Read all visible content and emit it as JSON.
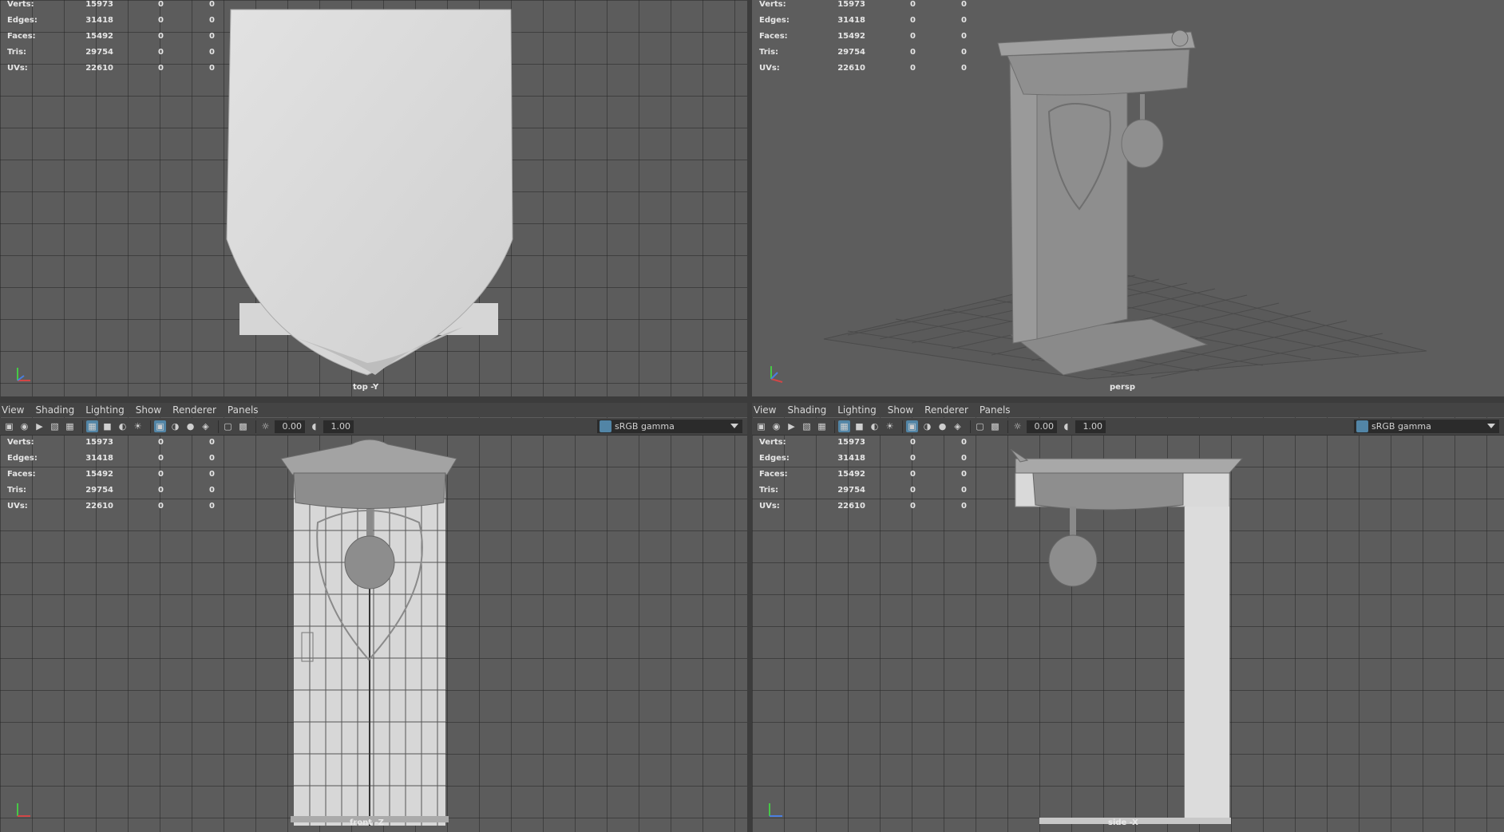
{
  "menu": [
    "View",
    "Shading",
    "Lighting",
    "Show",
    "Renderer",
    "Panels"
  ],
  "hud": {
    "labels": [
      "Verts:",
      "Edges:",
      "Faces:",
      "Tris:",
      "UVs:"
    ],
    "values": [
      "15973",
      "31418",
      "15492",
      "29754",
      "22610"
    ],
    "col2": "0",
    "col3": "0"
  },
  "toolbar": {
    "exposure": "0.00",
    "gamma": "1.00",
    "colorspace": "sRGB gamma"
  },
  "cameras": {
    "top": "top -Y",
    "persp": "persp",
    "front": "front -Z",
    "side": "side -X"
  },
  "axis": {
    "y": "Y",
    "x": "X",
    "z": "Z"
  },
  "colors": {
    "accent": "#5285a6",
    "viewport_bg": "#5c5c5c",
    "panel_bg": "#444444"
  }
}
